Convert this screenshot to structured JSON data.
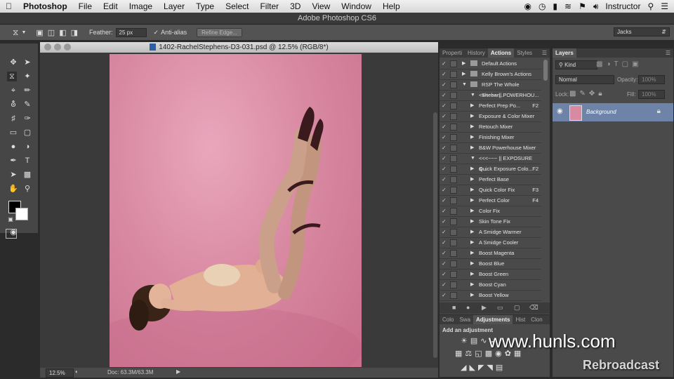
{
  "menubar": {
    "apple_icon": "apple-icon",
    "app_name": "Photoshop",
    "items": [
      "File",
      "Edit",
      "Image",
      "Layer",
      "Type",
      "Select",
      "Filter",
      "3D",
      "View",
      "Window",
      "Help"
    ],
    "user": "Instructor"
  },
  "window_title": "Adobe Photoshop CS6",
  "options_bar": {
    "feather_label": "Feather:",
    "feather_value": "25 px",
    "antialias_label": "Anti-alias",
    "refine_edge_label": "Refine Edge...",
    "workspace": "Jacks"
  },
  "document": {
    "title": "1402-RachelStephens-D3-031.psd @ 12.5% (RGB/8*)",
    "zoom": "12.5%",
    "doc_size": "Doc: 63.3M/63.3M"
  },
  "actions_panel": {
    "tabs": [
      "Properti",
      "History",
      "Actions",
      "Styles"
    ],
    "active_tab": "Actions",
    "rows": [
      {
        "name": "Default Actions",
        "key": "",
        "level": 0
      },
      {
        "name": "Kelly Brown's Actions",
        "key": "",
        "level": 0
      },
      {
        "name": "RSP The Whole Sheban...",
        "key": "",
        "level": 0
      },
      {
        "name": "<<<~~~ || POWERHOU...",
        "key": "",
        "level": 1
      },
      {
        "name": "Perfect Prep Po...",
        "key": "F2",
        "level": 1
      },
      {
        "name": "Exposure & Color Mixer",
        "key": "",
        "level": 1
      },
      {
        "name": "Retouch Mixer",
        "key": "",
        "level": 1
      },
      {
        "name": "Finishing Mixer",
        "key": "",
        "level": 1
      },
      {
        "name": "B&W Powerhouse Mixer",
        "key": "",
        "level": 1
      },
      {
        "name": "<<<~~~ || EXPOSURE &...",
        "key": "",
        "level": 1
      },
      {
        "name": "Quick Exposure Colo...",
        "key": "F2",
        "level": 1
      },
      {
        "name": "Perfect Base",
        "key": "",
        "level": 1
      },
      {
        "name": "Quick Color Fix",
        "key": "F3",
        "level": 1
      },
      {
        "name": "Perfect Color",
        "key": "F4",
        "level": 1
      },
      {
        "name": "Color Fix",
        "key": "",
        "level": 1
      },
      {
        "name": "Skin Tone Fix",
        "key": "",
        "level": 1
      },
      {
        "name": "A Smidge Warmer",
        "key": "",
        "level": 1
      },
      {
        "name": "A Smidge Cooler",
        "key": "",
        "level": 1
      },
      {
        "name": "Boost Magenta",
        "key": "",
        "level": 1
      },
      {
        "name": "Boost Blue",
        "key": "",
        "level": 1
      },
      {
        "name": "Boost Green",
        "key": "",
        "level": 1
      },
      {
        "name": "Boost Cyan",
        "key": "",
        "level": 1
      },
      {
        "name": "Boost Yellow",
        "key": "",
        "level": 1
      }
    ]
  },
  "adjustments_panel": {
    "tabs": [
      "Colo",
      "Swa",
      "Adjustments",
      "Hist",
      "Clon"
    ],
    "active_tab": "Adjustments",
    "heading": "Add an adjustment"
  },
  "layers_panel": {
    "tab": "Layers",
    "kind_filter": "Kind",
    "blend_mode": "Normal",
    "opacity_label": "Opacity:",
    "opacity_value": "100%",
    "lock_label": "Lock:",
    "fill_label": "Fill:",
    "fill_value": "100%",
    "layer_name": "Background"
  },
  "watermark": {
    "site": "www.hunls.com",
    "brand": "Rebroadcast"
  },
  "colors": {
    "canvas_pink": "#d98aa3",
    "panel_bg": "#4a4a4a",
    "selected_layer": "#6d84a8"
  }
}
